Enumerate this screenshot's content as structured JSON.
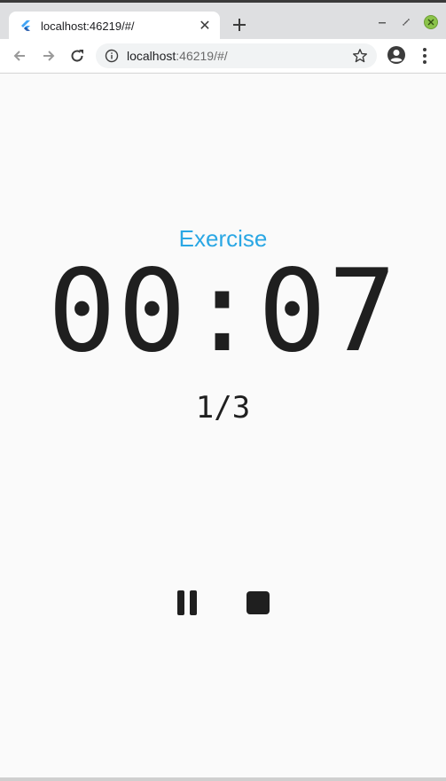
{
  "browser": {
    "tab": {
      "title": "localhost:46219/#/",
      "favicon": "flutter-icon"
    },
    "url": {
      "host": "localhost",
      "rest": ":46219/#/"
    },
    "icons": {
      "back": "arrow-left-icon",
      "forward": "arrow-right-icon",
      "reload": "reload-icon",
      "info": "info-icon",
      "bookmark": "star-icon",
      "profile": "account-circle-icon",
      "menu": "more-vert-icon",
      "new_tab": "plus-icon",
      "close_tab": "close-icon"
    }
  },
  "timer": {
    "phase": "Exercise",
    "time": "00:07",
    "round": "1/3"
  },
  "controls": {
    "pause_icon": "pause-icon",
    "stop_icon": "stop-icon"
  },
  "colors": {
    "accent": "#2aa7e4",
    "text": "#1f1f1f",
    "background": "#fafafa"
  }
}
